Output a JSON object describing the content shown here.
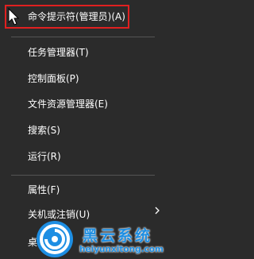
{
  "menu": {
    "items": [
      {
        "label": "命令提示符(管理员)(A)"
      },
      {
        "label": "任务管理器(T)"
      },
      {
        "label": "控制面板(P)"
      },
      {
        "label": "文件资源管理器(E)"
      },
      {
        "label": "搜索(S)"
      },
      {
        "label": "运行(R)"
      },
      {
        "label": "属性(F)"
      },
      {
        "label": "关机或注销(U)"
      },
      {
        "label": "桌"
      }
    ],
    "submenu_arrow_icon": "chevron-right-icon"
  },
  "watermark": {
    "title": "黑云系统",
    "url": "heiyunxitong.com"
  },
  "colors": {
    "menu_bg": "#2b2b2b",
    "text": "#ffffff",
    "highlight_border": "#e02020",
    "watermark_blue": "#1d8ee3"
  }
}
